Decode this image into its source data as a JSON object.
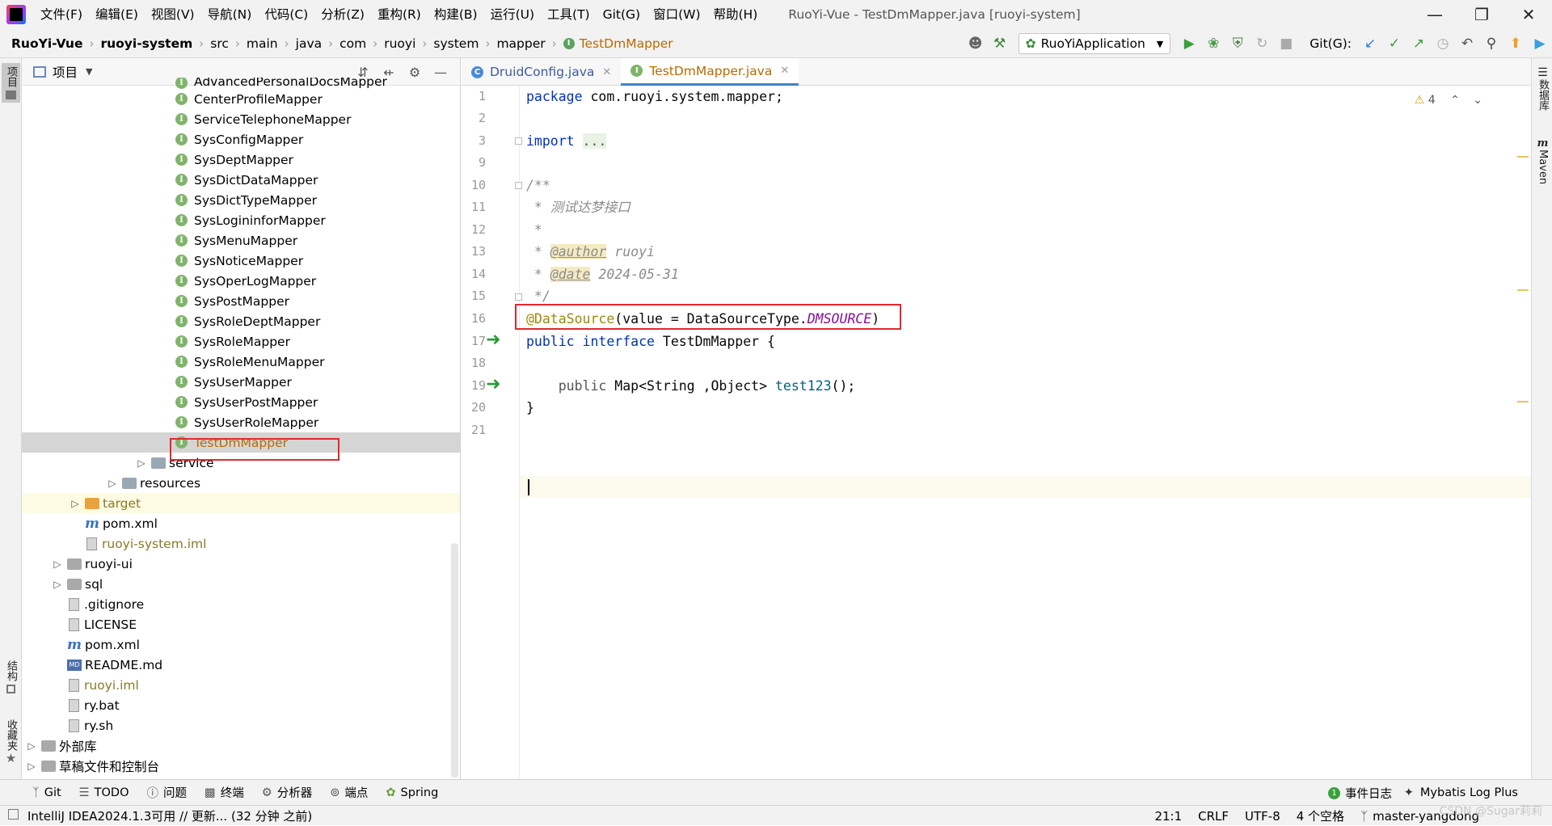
{
  "menubar": {
    "items": [
      "文件(F)",
      "编辑(E)",
      "视图(V)",
      "导航(N)",
      "代码(C)",
      "分析(Z)",
      "重构(R)",
      "构建(B)",
      "运行(U)",
      "工具(T)",
      "Git(G)",
      "窗口(W)",
      "帮助(H)"
    ],
    "window_title": "RuoYi-Vue - TestDmMapper.java [ruoyi-system]"
  },
  "breadcrumb": [
    "RuoYi-Vue",
    "ruoyi-system",
    "src",
    "main",
    "java",
    "com",
    "ruoyi",
    "system",
    "mapper",
    "TestDmMapper"
  ],
  "toolbar": {
    "run_config": "RuoYiApplication",
    "git_label": "Git(G):"
  },
  "left_strip": {
    "project": "项目",
    "structure": "结构",
    "favorites": "收藏夹"
  },
  "right_strip": {
    "database": "数据库",
    "maven": "Maven"
  },
  "project_panel": {
    "title": "项目",
    "partial_top_item": "AdvancedPersonalDocsMapper",
    "mappers": [
      "CenterProfileMapper",
      "ServiceTelephoneMapper",
      "SysConfigMapper",
      "SysDeptMapper",
      "SysDictDataMapper",
      "SysDictTypeMapper",
      "SysLogininforMapper",
      "SysMenuMapper",
      "SysNoticeMapper",
      "SysOperLogMapper",
      "SysPostMapper",
      "SysRoleDeptMapper",
      "SysRoleMapper",
      "SysRoleMenuMapper",
      "SysUserMapper",
      "SysUserPostMapper",
      "SysUserRoleMapper",
      "TestDmMapper"
    ],
    "service": "service",
    "resources": "resources",
    "target": "target",
    "pom_sub": "pom.xml",
    "iml_sub": "ruoyi-system.iml",
    "ruoyi_ui": "ruoyi-ui",
    "sql": "sql",
    "gitignore": ".gitignore",
    "license": "LICENSE",
    "pom_root": "pom.xml",
    "readme": "README.md",
    "iml_root": "ruoyi.iml",
    "ry_bat": "ry.bat",
    "ry_sh": "ry.sh",
    "external_libs": "外部库",
    "scratches": "草稿文件和控制台"
  },
  "editor": {
    "tabs": [
      {
        "label": "DruidConfig.java",
        "icon": "C"
      },
      {
        "label": "TestDmMapper.java",
        "icon": "I"
      }
    ],
    "warnings": "4",
    "line_numbers": [
      "1",
      "2",
      "3",
      "9",
      "10",
      "11",
      "12",
      "13",
      "14",
      "15",
      "16",
      "17",
      "18",
      "19",
      "20",
      "21"
    ],
    "code": {
      "l1_kw": "package",
      "l1_rest": " com.ruoyi.system.mapper;",
      "l3_kw": "import",
      "l3_fold": "...",
      "l10": "/**",
      "l11": " * 测试达梦接口",
      "l12": " *",
      "l13_pre": " * ",
      "l13_tag": "@author",
      "l13_val": " ruoyi",
      "l14_pre": " * ",
      "l14_tag": "@date",
      "l14_val": " 2024-05-31",
      "l15": " */",
      "l16_ann": "@DataSource",
      "l16_mid": "(value = DataSourceType.",
      "l16_const": "DMSOURCE",
      "l16_end": ")",
      "l17_kw": "public interface",
      "l17_rest": " TestDmMapper {",
      "l19_kw": "    public",
      "l19_mid": " Map<String ,Object> ",
      "l19_method": "test123",
      "l19_end": "();",
      "l20": "}"
    }
  },
  "bottom_tabs": [
    "Git",
    "TODO",
    "问题",
    "终端",
    "分析器",
    "端点",
    "Spring"
  ],
  "bottom_right": {
    "event_log": "事件日志",
    "mybatis": "Mybatis Log Plus"
  },
  "status": {
    "message": "IntelliJ IDEA2024.1.3可用 // 更新... (32 分钟 之前)",
    "position": "21:1",
    "line_sep": "CRLF",
    "encoding": "UTF-8",
    "indent": "4 个空格",
    "branch": "master-yangdong"
  },
  "watermark": "CSDN @Sugar莉莉"
}
